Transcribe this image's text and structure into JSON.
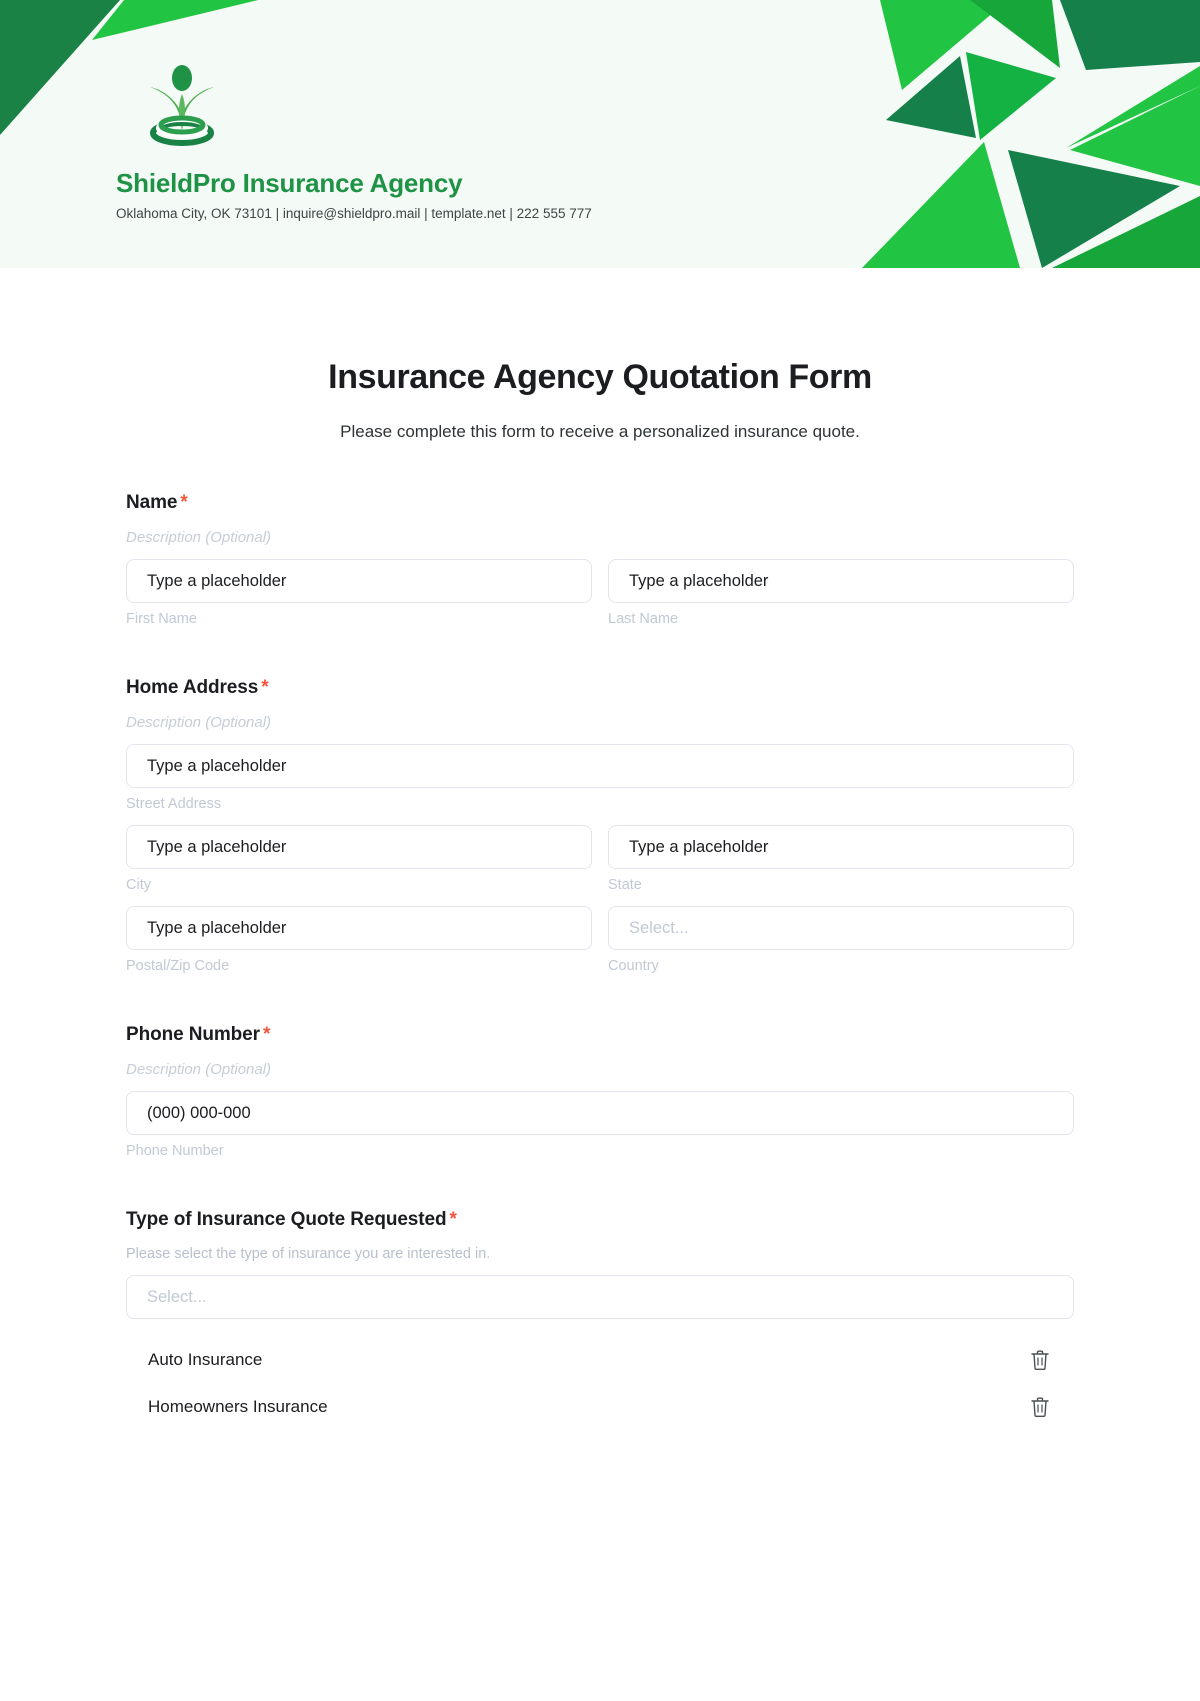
{
  "brand": {
    "name": "ShieldPro Insurance Agency",
    "contact": "Oklahoma City, OK 73101 | inquire@shieldpro.mail | template.net | 222 555 777",
    "logo_icon": "person-sprout-logo-icon",
    "accent_green": "#1e9245",
    "bright_green": "#22c543",
    "header_bg": "#f4faf5"
  },
  "form": {
    "title": "Insurance Agency Quotation Form",
    "subtitle": "Please complete this form to receive a personalized insurance quote.",
    "required_marker": "*",
    "required_color": "#f4563c"
  },
  "fields": {
    "name": {
      "label": "Name",
      "description": "Description (Optional)",
      "first": {
        "value": "Type a placeholder",
        "sub_label": "First Name"
      },
      "last": {
        "value": "Type a placeholder",
        "sub_label": "Last Name"
      }
    },
    "home_address": {
      "label": "Home Address",
      "description": "Description (Optional)",
      "street": {
        "value": "Type a placeholder",
        "sub_label": "Street Address"
      },
      "city": {
        "value": "Type a placeholder",
        "sub_label": "City"
      },
      "state": {
        "value": "Type a placeholder",
        "sub_label": "State"
      },
      "postal": {
        "value": "Type a placeholder",
        "sub_label": "Postal/Zip Code"
      },
      "country": {
        "value": "Select...",
        "sub_label": "Country"
      }
    },
    "phone": {
      "label": "Phone Number",
      "description": "Description (Optional)",
      "value": "(000) 000-000",
      "sub_label": "Phone Number"
    },
    "insurance_type": {
      "label": "Type of Insurance Quote Requested",
      "description": "Please select the type of insurance you are interested in.",
      "select_value": "Select...",
      "options": [
        {
          "label": "Auto Insurance",
          "delete_icon": "trash-icon"
        },
        {
          "label": "Homeowners Insurance",
          "delete_icon": "trash-icon"
        }
      ]
    }
  }
}
